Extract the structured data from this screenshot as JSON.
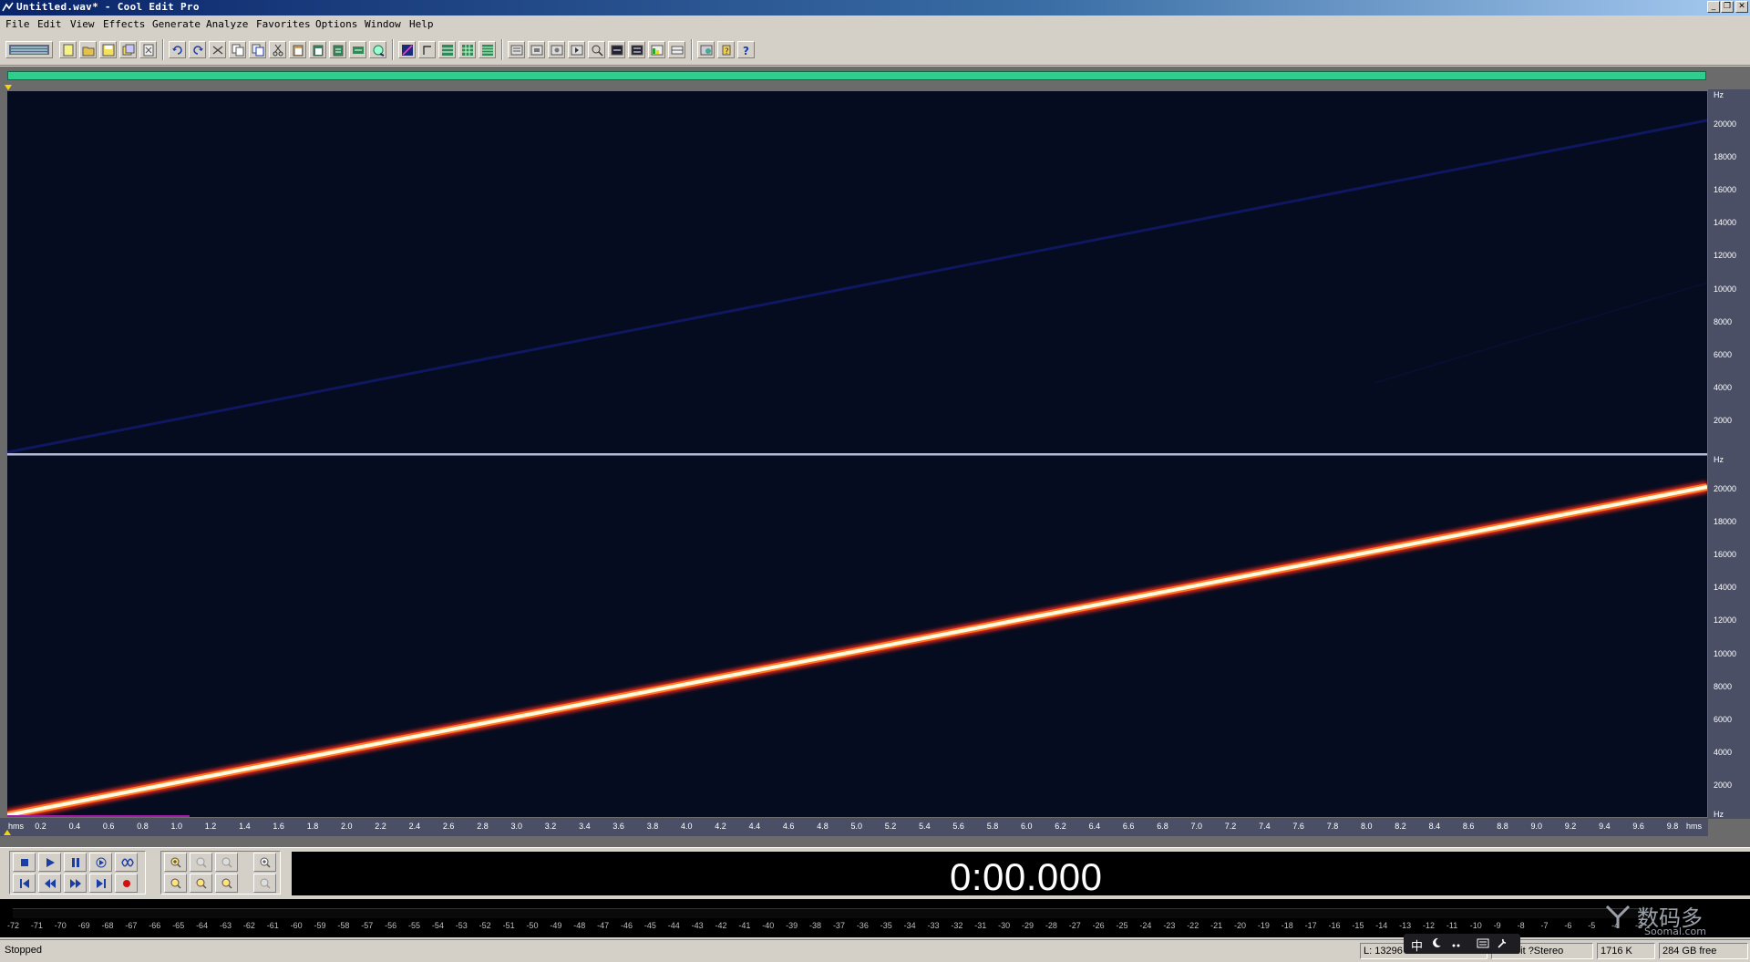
{
  "window": {
    "title": "Untitled.wav* - Cool Edit Pro",
    "minimize_label": "_",
    "restore_label": "❐",
    "close_label": "✕"
  },
  "menu": [
    "File",
    "Edit",
    "View",
    "Effects",
    "Generate",
    "Analyze",
    "Favorites",
    "Options",
    "Window",
    "Help"
  ],
  "toolbar": {
    "icons": [
      "multitrack-toggle-icon",
      "new-file-icon",
      "open-file-icon",
      "save-file-icon",
      "save-all-icon",
      "close-file-icon",
      "undo-icon",
      "redo-icon",
      "repeat-last-icon",
      "copy-icon",
      "copy-to-new-icon",
      "cut-icon",
      "paste-icon",
      "paste-to-new-icon",
      "mix-paste-icon",
      "trim-icon",
      "cd-play-icon",
      "waveform-view-icon",
      "spectral-view-icon",
      "frequency-analysis-icon",
      "snap-icon",
      "grid-icon",
      "cue-list-icon",
      "play-list-icon",
      "settings-icon",
      "info-icon",
      "instant-play-icon",
      "time-window-icon",
      "metronome-icon",
      "level-meter-icon",
      "scripts-icon",
      "preferences-icon",
      "help-icon"
    ]
  },
  "spectral": {
    "freq_unit": "Hz",
    "freq_labels": [
      "20000",
      "18000",
      "16000",
      "14000",
      "12000",
      "10000",
      "8000",
      "6000",
      "4000",
      "2000"
    ],
    "time_unit": "hms",
    "time_labels": [
      "0.2",
      "0.4",
      "0.6",
      "0.8",
      "1.0",
      "1.2",
      "1.4",
      "1.6",
      "1.8",
      "2.0",
      "2.2",
      "2.4",
      "2.6",
      "2.8",
      "3.0",
      "3.2",
      "3.4",
      "3.6",
      "3.8",
      "4.0",
      "4.2",
      "4.4",
      "4.6",
      "4.8",
      "5.0",
      "5.2",
      "5.4",
      "5.6",
      "5.8",
      "6.0",
      "6.2",
      "6.4",
      "6.6",
      "6.8",
      "7.0",
      "7.2",
      "7.4",
      "7.6",
      "7.8",
      "8.0",
      "8.2",
      "8.4",
      "8.6",
      "8.8",
      "9.0",
      "9.2",
      "9.4",
      "9.6",
      "9.8"
    ],
    "sweep_start_hz": 0,
    "sweep_end_hz": 20000,
    "sweep_end_time_s": 10,
    "colors": {
      "background": "#050c1f",
      "sweep_core": "#fffbe0",
      "sweep_glow": "#ff2a1a"
    }
  },
  "transport": {
    "time_display": "0:00.000",
    "buttons": [
      "stop",
      "play",
      "pause",
      "play-to-end",
      "loop",
      "go-to-start",
      "rewind",
      "fast-forward",
      "go-to-end",
      "record"
    ],
    "zoom_buttons": [
      "zoom-in-horizontal",
      "zoom-out-horizontal",
      "zoom-full",
      "zoom-in-vertical",
      "zoom-in-left",
      "zoom-in-right",
      "zoom-selection",
      "zoom-out-vertical"
    ]
  },
  "level_meter": {
    "unit": "dB",
    "labels": [
      "-72",
      "-71",
      "-70",
      "-69",
      "-68",
      "-67",
      "-66",
      "-65",
      "-64",
      "-63",
      "-62",
      "-61",
      "-60",
      "-59",
      "-58",
      "-57",
      "-56",
      "-55",
      "-54",
      "-53",
      "-52",
      "-51",
      "-50",
      "-49",
      "-48",
      "-47",
      "-46",
      "-45",
      "-44",
      "-43",
      "-42",
      "-41",
      "-40",
      "-39",
      "-38",
      "-37",
      "-36",
      "-35",
      "-34",
      "-33",
      "-32",
      "-31",
      "-30",
      "-29",
      "-28",
      "-27",
      "-26",
      "-25",
      "-24",
      "-23",
      "-22",
      "-21",
      "-20",
      "-19",
      "-18",
      "-17",
      "-16",
      "-15",
      "-14",
      "-13",
      "-12",
      "-11",
      "-10",
      "-9",
      "-8",
      "-7",
      "-6",
      "-5",
      "-4",
      "-3"
    ]
  },
  "status": {
    "state": "Stopped",
    "sel": "L: 13296",
    "format": "?16-bit ?Stereo",
    "size": "1716 K",
    "free": "284 GB free"
  },
  "ime": {
    "label": "中"
  },
  "watermark": {
    "text": "数码多",
    "sub": "Soomal.com"
  }
}
